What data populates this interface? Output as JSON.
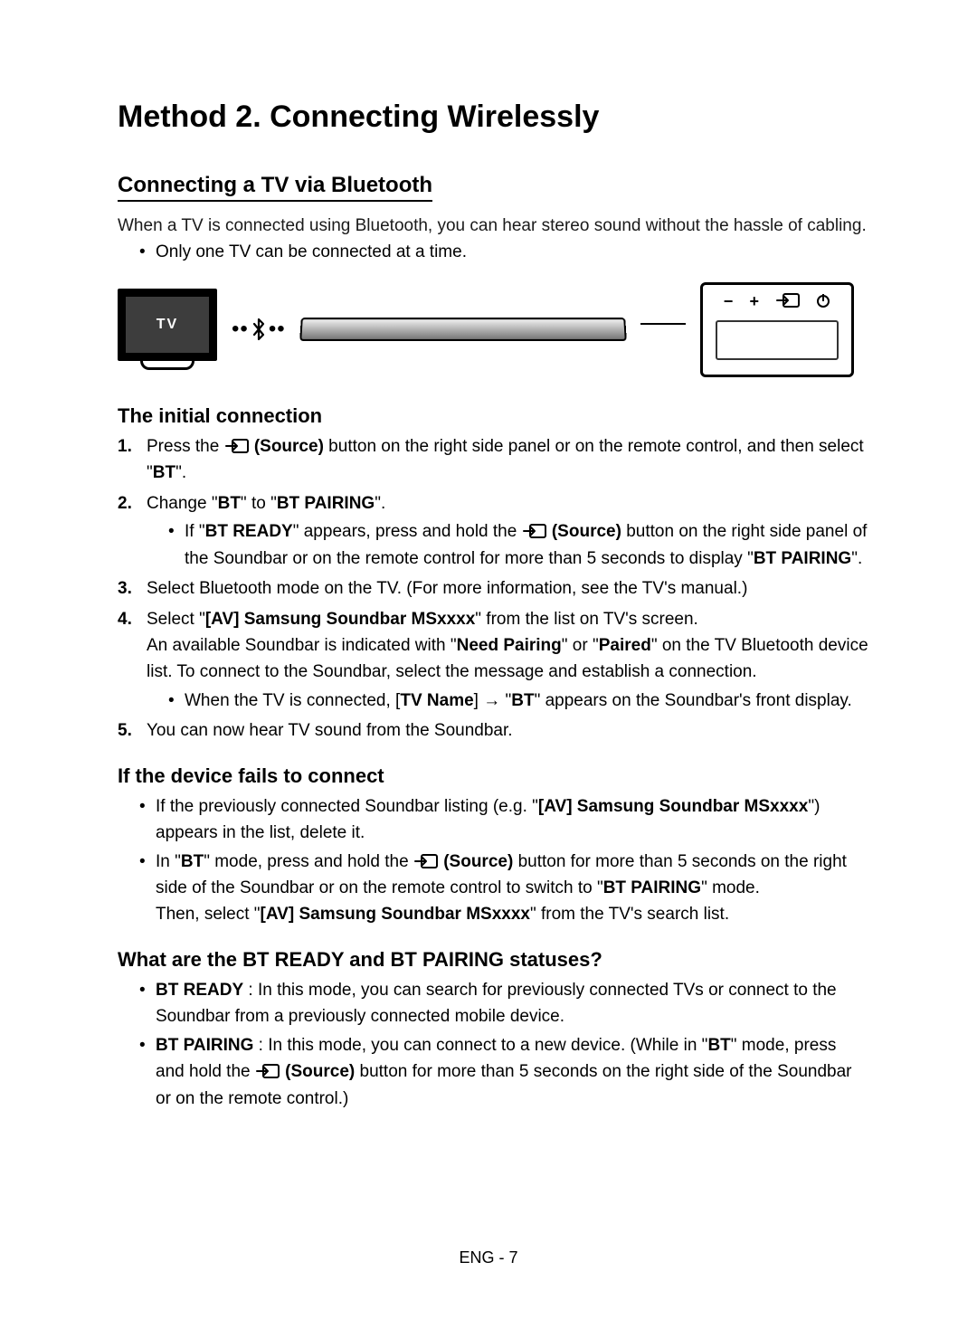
{
  "page": {
    "title": "Method 2. Connecting Wirelessly",
    "footer_page": "ENG - 7"
  },
  "section1": {
    "heading": "Connecting a TV via Bluetooth",
    "intro": "When a TV is connected using Bluetooth, you can hear stereo sound without the hassle of cabling.",
    "bullet1": "Only one TV can be connected at a time."
  },
  "diagram": {
    "tv_label": "TV",
    "minus": "−",
    "plus": "+"
  },
  "initial": {
    "heading": "The initial connection",
    "step1_a": "Press the ",
    "step1_b": " (Source)",
    "step1_c": " button on the right side panel or on the remote control, and then select \"",
    "step1_d": "BT",
    "step1_e": "\".",
    "step2_a": "Change \"",
    "step2_b": "BT",
    "step2_c": "\" to \"",
    "step2_d": "BT PAIRING",
    "step2_e": "\".",
    "step2_sub_a": "If \"",
    "step2_sub_b": "BT READY",
    "step2_sub_c": "\" appears, press and hold the ",
    "step2_sub_d": " (Source)",
    "step2_sub_e": " button on the right side panel of the Soundbar or on the remote control for more than 5 seconds to display \"",
    "step2_sub_f": "BT PAIRING",
    "step2_sub_g": "\".",
    "step3": "Select Bluetooth mode on the TV. (For more information, see the TV's manual.)",
    "step4_a": "Select \"",
    "step4_b": "[AV] Samsung Soundbar MSxxxx",
    "step4_c": "\" from the list on TV's screen.",
    "step4_line2_a": "An available Soundbar is indicated with \"",
    "step4_line2_b": "Need Pairing",
    "step4_line2_c": "\" or \"",
    "step4_line2_d": "Paired",
    "step4_line2_e": "\" on the TV Bluetooth device list. To connect to the Soundbar, select the message and establish a connection.",
    "step4_sub_a": "When the TV is connected, [",
    "step4_sub_b": "TV Name",
    "step4_sub_c": "] → \"",
    "step4_sub_d": "BT",
    "step4_sub_e": "\" appears on the Soundbar's front display.",
    "step5": "You can now hear TV sound from the Soundbar."
  },
  "fails": {
    "heading": "If the device fails to connect",
    "b1_a": "If the previously connected Soundbar listing (e.g. \"",
    "b1_b": "[AV] Samsung Soundbar MSxxxx",
    "b1_c": "\") appears in the list, delete it.",
    "b2_a": "In \"",
    "b2_b": "BT",
    "b2_c": "\" mode, press and hold the ",
    "b2_d": " (Source)",
    "b2_e": " button for more than 5 seconds on the right side of the Soundbar or on the remote control to switch to \"",
    "b2_f": "BT PAIRING",
    "b2_g": "\" mode.",
    "b2_line2_a": "Then, select \"",
    "b2_line2_b": "[AV] Samsung Soundbar MSxxxx",
    "b2_line2_c": "\" from the TV's search list."
  },
  "statuses": {
    "heading": "What are the BT READY and BT PAIRING statuses?",
    "b1_a": "BT READY",
    "b1_b": " : In this mode, you can search for previously connected TVs or connect to the Soundbar from a previously connected mobile device.",
    "b2_a": "BT PAIRING",
    "b2_b": " : In this mode, you can connect to a new device. (While in \"",
    "b2_c": "BT",
    "b2_d": "\" mode, press and hold the ",
    "b2_e": " (Source)",
    "b2_f": " button for more than 5 seconds on the right side of the Soundbar or on the remote control.)"
  }
}
